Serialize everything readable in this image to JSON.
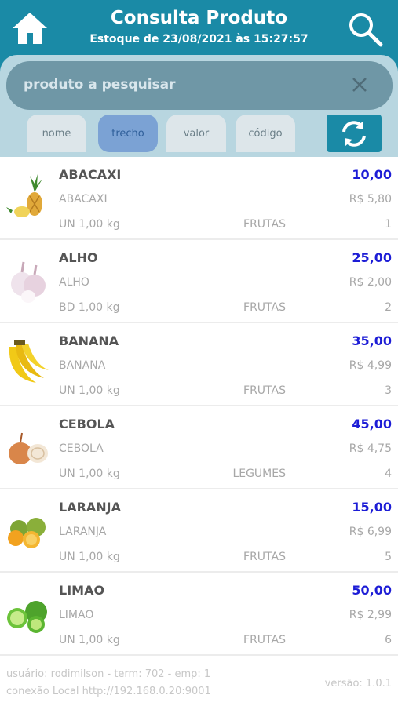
{
  "header": {
    "title": "Consulta Produto",
    "subtitle": "Estoque de 23/08/2021 às 15:27:57"
  },
  "search": {
    "placeholder": "produto a pesquisar"
  },
  "filters": [
    {
      "label": "nome",
      "active": false
    },
    {
      "label": "trecho",
      "active": true
    },
    {
      "label": "valor",
      "active": false
    },
    {
      "label": "código",
      "active": false
    }
  ],
  "products": [
    {
      "name": "ABACAXI",
      "desc": "ABACAXI",
      "unit": "UN 1,00 kg",
      "category": "FRUTAS",
      "qty": "10,00",
      "price": "R$ 5,80",
      "code": "1",
      "icon": "pineapple-icon"
    },
    {
      "name": "ALHO",
      "desc": "ALHO",
      "unit": "BD 1,00 kg",
      "category": "FRUTAS",
      "qty": "25,00",
      "price": "R$ 2,00",
      "code": "2",
      "icon": "garlic-icon"
    },
    {
      "name": "BANANA",
      "desc": "BANANA",
      "unit": "UN 1,00 kg",
      "category": "FRUTAS",
      "qty": "35,00",
      "price": "R$ 4,99",
      "code": "3",
      "icon": "banana-icon"
    },
    {
      "name": "CEBOLA",
      "desc": "CEBOLA",
      "unit": "UN 1,00 kg",
      "category": "LEGUMES",
      "qty": "45,00",
      "price": "R$ 4,75",
      "code": "4",
      "icon": "onion-icon"
    },
    {
      "name": "LARANJA",
      "desc": "LARANJA",
      "unit": "UN 1,00 kg",
      "category": "FRUTAS",
      "qty": "15,00",
      "price": "R$ 6,99",
      "code": "5",
      "icon": "orange-icon"
    },
    {
      "name": "LIMAO",
      "desc": "LIMAO",
      "unit": "UN 1,00 kg",
      "category": "FRUTAS",
      "qty": "50,00",
      "price": "R$ 2,99",
      "code": "6",
      "icon": "lime-icon"
    }
  ],
  "footer": {
    "user": "usuário: rodimilson - term: 702 - emp: 1",
    "connection": "conexão Local http://192.168.0.20:9001",
    "version": "versão: 1.0.1"
  },
  "colors": {
    "header": "#1a8aa6",
    "quantity": "#1d1dd6",
    "panel": "#b8d6e0"
  }
}
